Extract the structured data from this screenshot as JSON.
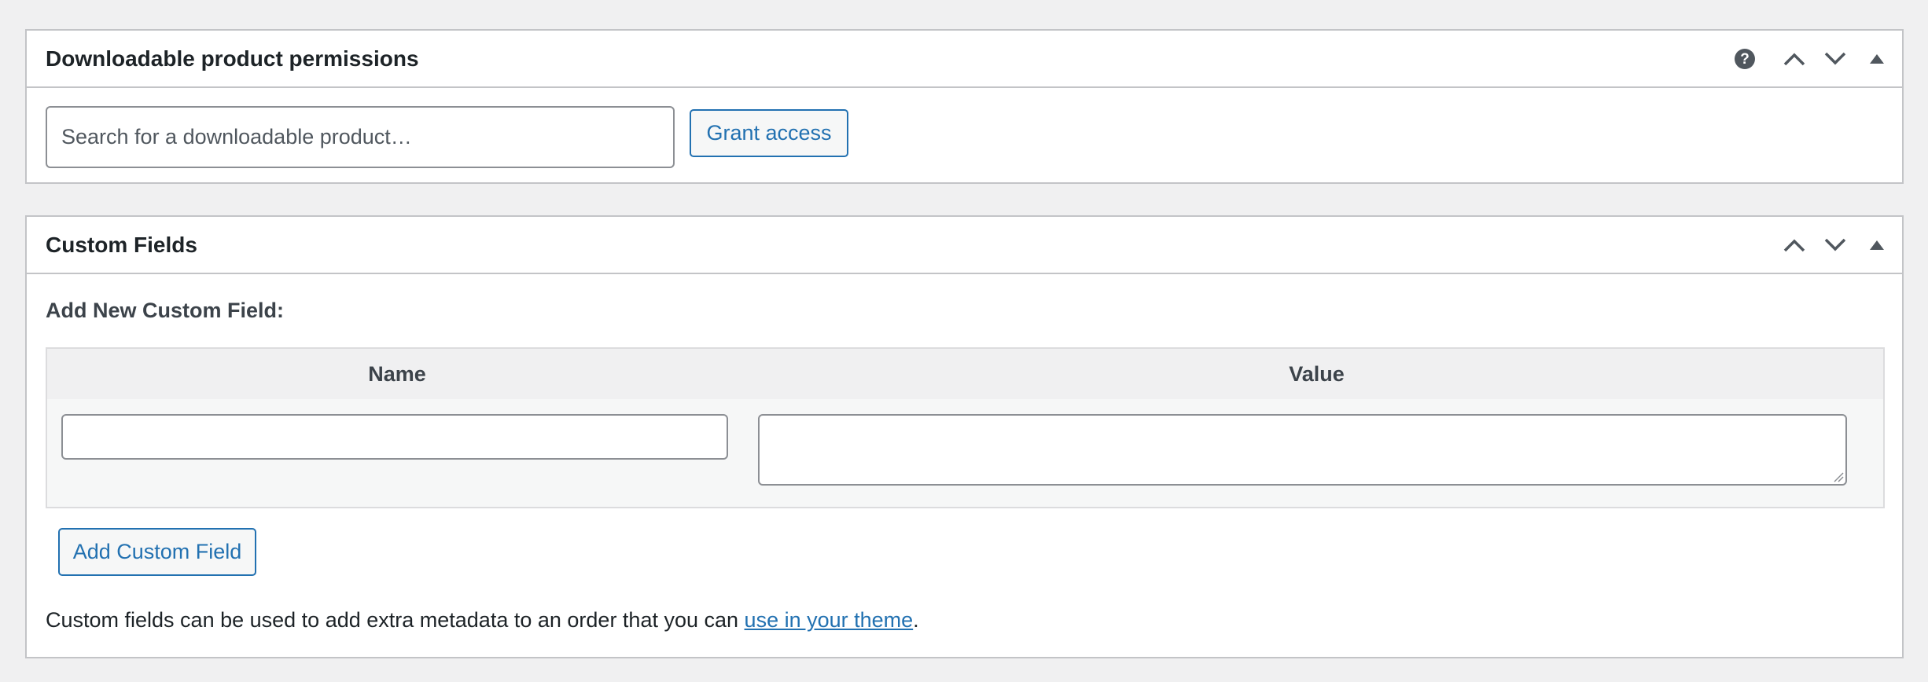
{
  "downloads_box": {
    "title": "Downloadable product permissions",
    "help_icon": "question-mark",
    "search_placeholder": "Search for a downloadable product…",
    "grant_label": "Grant access"
  },
  "custom_fields_box": {
    "title": "Custom Fields",
    "section_label": "Add New Custom Field:",
    "columns": [
      "Name",
      "Value"
    ],
    "name_value": "",
    "value_value": "",
    "add_label": "Add Custom Field",
    "help_text_before": "Custom fields can be used to add extra metadata to an order that you can ",
    "help_link": "use in your theme",
    "help_text_after": "."
  },
  "colors": {
    "accent": "#2271b1",
    "border": "#c3c4c7",
    "background": "#f0f0f1"
  }
}
